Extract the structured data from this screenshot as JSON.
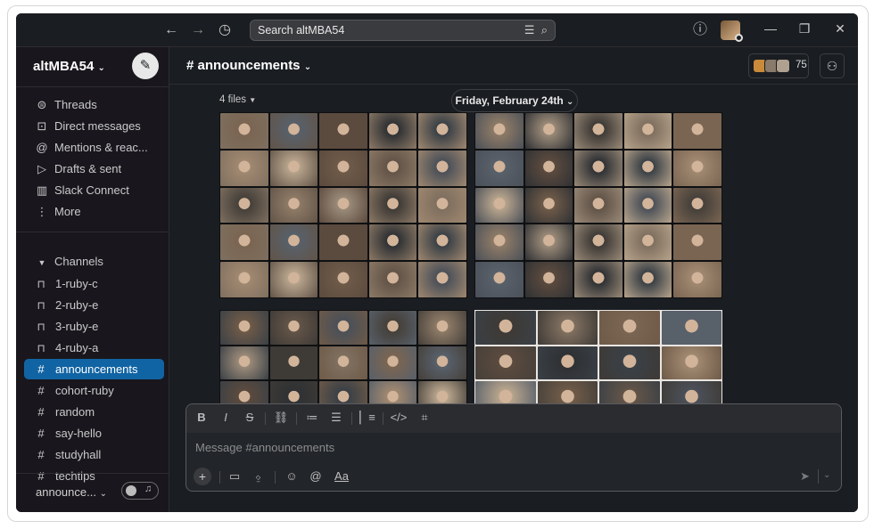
{
  "titlebar": {
    "search_text": "Search altMBA54"
  },
  "sidebar": {
    "workspace": "altMBA54",
    "nav": [
      {
        "label": "Threads",
        "icon": "threads-icon",
        "glyph": "⊜"
      },
      {
        "label": "Direct messages",
        "icon": "direct-messages-icon",
        "glyph": "⊡"
      },
      {
        "label": "Mentions & reac...",
        "icon": "mention-icon",
        "glyph": "@"
      },
      {
        "label": "Drafts & sent",
        "icon": "send-icon",
        "glyph": "▷"
      },
      {
        "label": "Slack Connect",
        "icon": "building-icon",
        "glyph": "▥"
      },
      {
        "label": "More",
        "icon": "more-icon",
        "glyph": "⋮"
      }
    ],
    "channels_header": "Channels",
    "channels": [
      {
        "label": "1-ruby-c",
        "private": true
      },
      {
        "label": "2-ruby-e",
        "private": true
      },
      {
        "label": "3-ruby-e",
        "private": true
      },
      {
        "label": "4-ruby-a",
        "private": true
      },
      {
        "label": "announcements",
        "private": false,
        "active": true
      },
      {
        "label": "cohort-ruby",
        "private": false
      },
      {
        "label": "random",
        "private": false
      },
      {
        "label": "say-hello",
        "private": false
      },
      {
        "label": "studyhall",
        "private": false
      },
      {
        "label": "techtips",
        "private": false
      }
    ],
    "bottom_label": "announce..."
  },
  "header": {
    "channel_title": "# announcements",
    "member_count": "75"
  },
  "messages": {
    "files_label": "4 files",
    "date_label": "Friday, February 24th"
  },
  "composer": {
    "placeholder": "Message #announcements"
  },
  "colors": {
    "active_channel": "#1164a3",
    "background": "#1a1d21",
    "sidebar": "#19171d"
  }
}
